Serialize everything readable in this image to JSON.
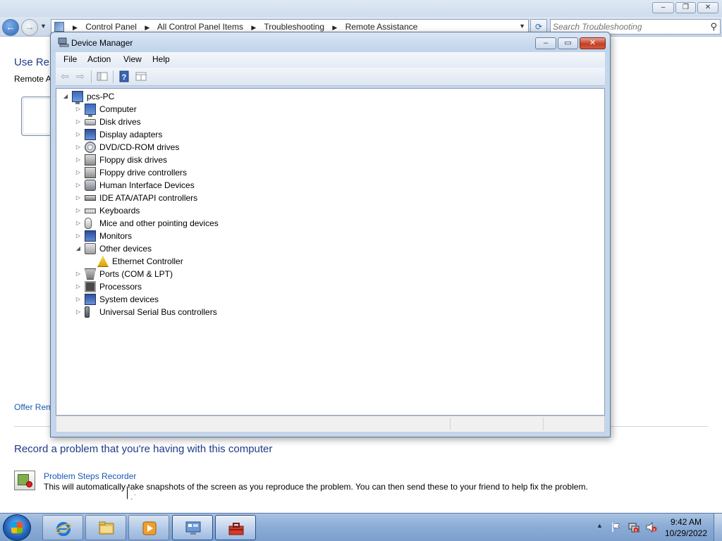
{
  "control_panel": {
    "breadcrumbs": [
      "Control Panel",
      "All Control Panel Items",
      "Troubleshooting",
      "Remote Assistance"
    ],
    "search_placeholder": "Search Troubleshooting",
    "heading_1": "Use Rem",
    "text_1": "Remote A",
    "offer_link": "Offer Rem",
    "heading_2": "Record a problem that you're having with this computer",
    "psr_link": "Problem Steps Recorder",
    "psr_description": "This will automatically take snapshots of the screen as you reproduce the problem. You can then send these to your friend to help fix the problem."
  },
  "device_manager": {
    "title": "Device Manager",
    "menu": [
      "File",
      "Action",
      "View",
      "Help"
    ],
    "root": "pcs-PC",
    "categories": [
      {
        "label": "Computer",
        "icon": "computer-icon",
        "expanded": false
      },
      {
        "label": "Disk drives",
        "icon": "disk-drive-icon",
        "expanded": false
      },
      {
        "label": "Display adapters",
        "icon": "display-adapter-icon",
        "expanded": false
      },
      {
        "label": "DVD/CD-ROM drives",
        "icon": "dvd-drive-icon",
        "expanded": false
      },
      {
        "label": "Floppy disk drives",
        "icon": "floppy-drive-icon",
        "expanded": false
      },
      {
        "label": "Floppy drive controllers",
        "icon": "floppy-controller-icon",
        "expanded": false
      },
      {
        "label": "Human Interface Devices",
        "icon": "hid-icon",
        "expanded": false
      },
      {
        "label": "IDE ATA/ATAPI controllers",
        "icon": "ide-controller-icon",
        "expanded": false
      },
      {
        "label": "Keyboards",
        "icon": "keyboard-icon",
        "expanded": false
      },
      {
        "label": "Mice and other pointing devices",
        "icon": "mouse-icon",
        "expanded": false
      },
      {
        "label": "Monitors",
        "icon": "monitor-icon",
        "expanded": false
      },
      {
        "label": "Other devices",
        "icon": "other-devices-icon",
        "expanded": true,
        "children": [
          {
            "label": "Ethernet Controller",
            "icon": "warning-device-icon"
          }
        ]
      },
      {
        "label": "Ports (COM & LPT)",
        "icon": "port-icon",
        "expanded": false
      },
      {
        "label": "Processors",
        "icon": "processor-icon",
        "expanded": false
      },
      {
        "label": "System devices",
        "icon": "system-devices-icon",
        "expanded": false
      },
      {
        "label": "Universal Serial Bus controllers",
        "icon": "usb-controller-icon",
        "expanded": false
      }
    ]
  },
  "taskbar": {
    "apps": [
      {
        "name": "internet-explorer",
        "active": false
      },
      {
        "name": "windows-explorer",
        "active": false
      },
      {
        "name": "media-player",
        "active": false
      },
      {
        "name": "control-panel",
        "active": true
      },
      {
        "name": "device-manager",
        "active": true
      }
    ],
    "time": "9:42 AM",
    "date": "10/29/2022"
  }
}
